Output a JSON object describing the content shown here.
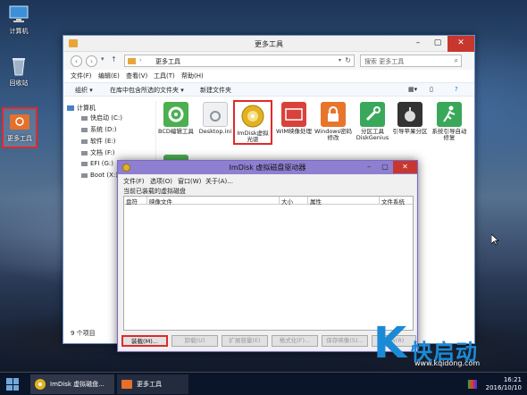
{
  "desktop": {
    "icons": [
      {
        "label": "计算机"
      },
      {
        "label": "回收站"
      },
      {
        "label": "更多工具"
      }
    ]
  },
  "explorer": {
    "title": "更多工具",
    "address": "更多工具",
    "address_sep": "›",
    "search_placeholder": "搜索 更多工具",
    "menu": [
      "文件(F)",
      "编辑(E)",
      "查看(V)",
      "工具(T)",
      "帮助(H)"
    ],
    "toolbar": [
      "组织 ▾",
      "在库中包含所选的文件夹 ▾",
      "新建文件夹"
    ],
    "sidebar": [
      "计算机",
      "快启动 (C:)",
      "系统 (D:)",
      "软件 (E:)",
      "文档 (F:)",
      "EFI (G:)",
      "Boot (X:)"
    ],
    "items": [
      {
        "label": "BCD编辑工具",
        "icon": "gear-icon",
        "color": "#4caf50"
      },
      {
        "label": "Desktop.ini",
        "icon": "settings-file-icon",
        "color": "#d0d4d9"
      },
      {
        "label": "ImDisk虚拟光驱",
        "icon": "disc-icon",
        "color": "#e3b21f"
      },
      {
        "label": "WIM映像处理",
        "icon": "wim-icon",
        "color": "#d9423a"
      },
      {
        "label": "Windows密码修改",
        "icon": "lock-icon",
        "color": "#e8752c"
      },
      {
        "label": "分区工具DiskGenius",
        "icon": "wrench-icon",
        "color": "#3aa85a"
      },
      {
        "label": "引导苹果分区",
        "icon": "apple-icon",
        "color": "#333333"
      },
      {
        "label": "系统引导自动修复",
        "icon": "runner-icon",
        "color": "#3aa85a"
      }
    ],
    "status": "9 个项目"
  },
  "imdisk": {
    "title": "ImDisk 虚拟磁盘驱动器",
    "menu": [
      "文件(F)",
      "选项(O)",
      "窗口(W)",
      "关于(A)..."
    ],
    "label": "当前已装载的虚拟磁盘",
    "columns": [
      "盘符",
      "映像文件",
      "大小",
      "属性",
      "文件系统"
    ],
    "buttons": [
      "装载(M)...",
      "卸载(U)",
      "扩展容量(E)",
      "格式化(F)...",
      "保存映像(S)...",
      "刷新(R)"
    ]
  },
  "watermark": {
    "k": "K",
    "brand": "快启动",
    "url": "www.kqidong.com"
  },
  "taskbar": {
    "tasks": [
      "ImDisk 虚拟磁盘...",
      "更多工具"
    ],
    "time": "16:21",
    "date": "2016/10/10"
  }
}
